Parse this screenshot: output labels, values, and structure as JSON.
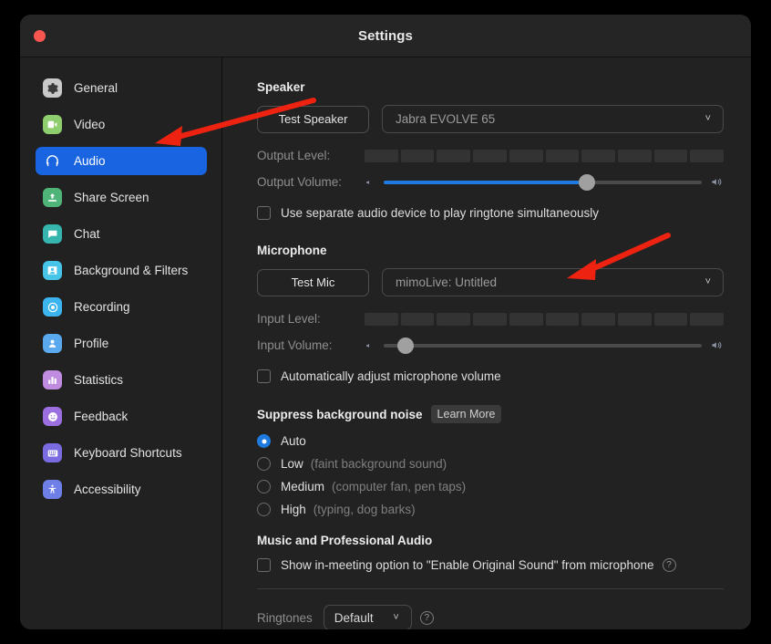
{
  "window": {
    "title": "Settings",
    "close_button": "close"
  },
  "sidebar": {
    "items": [
      {
        "label": "General",
        "icon": "gear-icon",
        "color": "#c9c9c9",
        "active": false
      },
      {
        "label": "Video",
        "icon": "video-camera-icon",
        "color": "#8fce6e",
        "active": false
      },
      {
        "label": "Audio",
        "icon": "headphones-icon",
        "color": "#1964e0",
        "active": true
      },
      {
        "label": "Share Screen",
        "icon": "share-screen-icon",
        "color": "#4fb477",
        "active": false
      },
      {
        "label": "Chat",
        "icon": "chat-bubble-icon",
        "color": "#35b5ae",
        "active": false
      },
      {
        "label": "Background & Filters",
        "icon": "person-frame-icon",
        "color": "#46c5e8",
        "active": false
      },
      {
        "label": "Recording",
        "icon": "record-icon",
        "color": "#3cb4ef",
        "active": false
      },
      {
        "label": "Profile",
        "icon": "profile-icon",
        "color": "#5aa8ee",
        "active": false
      },
      {
        "label": "Statistics",
        "icon": "bar-chart-icon",
        "color": "#c08ce0",
        "active": false
      },
      {
        "label": "Feedback",
        "icon": "smiley-icon",
        "color": "#9b6fe0",
        "active": false
      },
      {
        "label": "Keyboard Shortcuts",
        "icon": "keyboard-icon",
        "color": "#7a6ce0",
        "active": false
      },
      {
        "label": "Accessibility",
        "icon": "accessibility-icon",
        "color": "#6f7fe8",
        "active": false
      }
    ]
  },
  "speaker": {
    "heading": "Speaker",
    "test_button": "Test Speaker",
    "device": "Jabra EVOLVE 65",
    "output_level_label": "Output Level:",
    "output_level_segments": 10,
    "output_level_active": 0,
    "output_volume_label": "Output Volume:",
    "output_volume_percent": 64,
    "ringtone_checkbox": "Use separate audio device to play ringtone simultaneously",
    "ringtone_checked": false
  },
  "microphone": {
    "heading": "Microphone",
    "test_button": "Test Mic",
    "device": "mimoLive: Untitled",
    "input_level_label": "Input Level:",
    "input_level_segments": 10,
    "input_level_active": 0,
    "input_volume_label": "Input Volume:",
    "input_volume_percent": 7,
    "auto_adjust_checkbox": "Automatically adjust microphone volume",
    "auto_adjust_checked": false
  },
  "suppress_noise": {
    "heading": "Suppress background noise",
    "learn_more": "Learn More",
    "options": [
      {
        "label": "Auto",
        "hint": "",
        "selected": true
      },
      {
        "label": "Low",
        "hint": "(faint background sound)",
        "selected": false
      },
      {
        "label": "Medium",
        "hint": "(computer fan, pen taps)",
        "selected": false
      },
      {
        "label": "High",
        "hint": "(typing, dog barks)",
        "selected": false
      }
    ]
  },
  "music_audio": {
    "heading": "Music and Professional Audio",
    "original_sound_checkbox": "Show in-meeting option to \"Enable Original Sound\" from microphone",
    "original_sound_checked": false,
    "help_icon": "question-mark-icon"
  },
  "ringtones": {
    "label": "Ringtones",
    "value": "Default",
    "help_icon": "question-mark-icon"
  },
  "annotations": {
    "arrow_color": "#ee2211",
    "arrow_1": "points to Audio sidebar item",
    "arrow_2": "points to microphone device dropdown"
  }
}
